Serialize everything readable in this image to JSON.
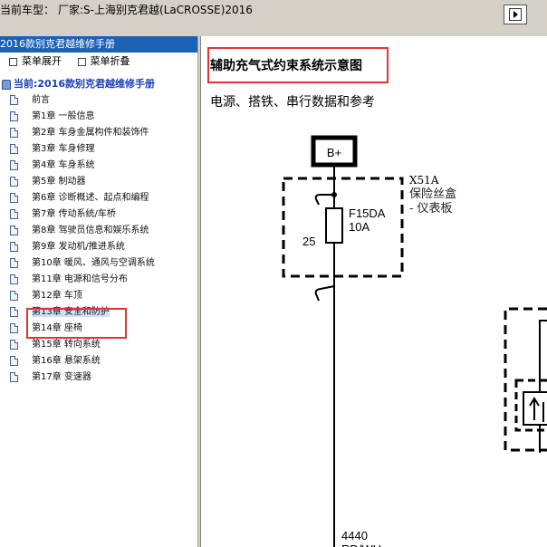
{
  "header": {
    "car_label": "当前车型：",
    "car_value": "厂家:S-上海别克君越(LaCROSSE)2016"
  },
  "sidebar": {
    "title": "2016款别克君越维修手册",
    "expand": "菜单展开",
    "collapse": "菜单折叠",
    "root": "当前:2016款别克君越维修手册",
    "items": [
      {
        "label": "前言"
      },
      {
        "label": "第1章 一般信息"
      },
      {
        "label": "第2章 车身金属构件和装饰件"
      },
      {
        "label": "第3章 车身修理"
      },
      {
        "label": "第4章 车身系统"
      },
      {
        "label": "第5章 制动器"
      },
      {
        "label": "第6章 诊断概述、起点和编程"
      },
      {
        "label": "第7章 传动系统/车桥"
      },
      {
        "label": "第8章 驾驶员信息和娱乐系统"
      },
      {
        "label": "第9章 发动机/推进系统"
      },
      {
        "label": "第10章 暖风、通风与空调系统"
      },
      {
        "label": "第11章 电源和信号分布"
      },
      {
        "label": "第12章 车顶"
      },
      {
        "label": "第13章 安全和防护"
      },
      {
        "label": "第14章 座椅"
      },
      {
        "label": "第15章 转向系统"
      },
      {
        "label": "第16章 悬架系统"
      },
      {
        "label": "第17章 变速器"
      }
    ]
  },
  "main": {
    "title": "辅助充气式约束系统示意图",
    "subtitle": "电源、搭铁、串行数据和参考",
    "diagram": {
      "power": "B+",
      "connector": "X51A",
      "fusebox_line1": "保险丝盒",
      "fusebox_line2": "- 仪表板",
      "fuse_name": "F15DA",
      "fuse_rating": "10A",
      "pin": "25",
      "circuit": "4440",
      "wire_color": "RD/WH"
    }
  },
  "colors": {
    "accent": "#1b62b5",
    "highlight_box": "#e53333",
    "selected_bg": "#cfe0f7"
  },
  "icons": {
    "nav": "next-frame-icon",
    "doc": "document-icon",
    "root": "book-icon"
  }
}
